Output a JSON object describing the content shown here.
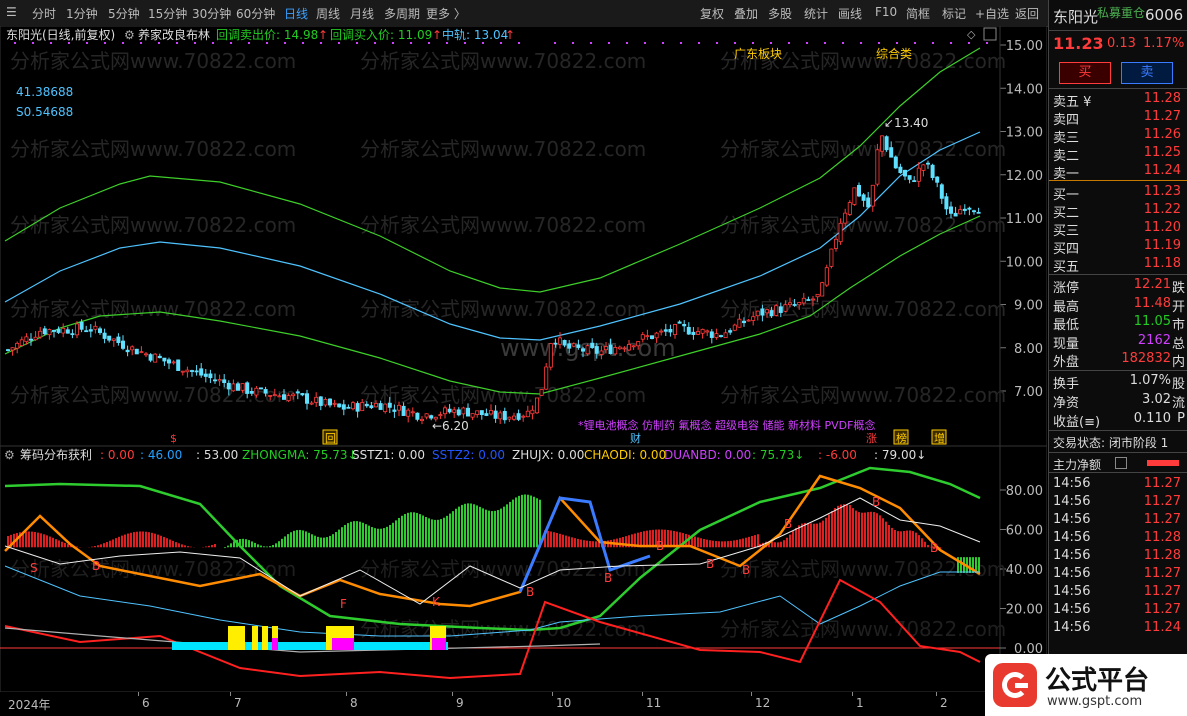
{
  "toolbar": {
    "periods": [
      "分时",
      "1分钟",
      "5分钟",
      "15分钟",
      "30分钟",
      "60分钟",
      "日线",
      "周线",
      "月线",
      "多周期",
      "更多 〉"
    ],
    "active_period": "日线",
    "actions": [
      "复权",
      "叠加",
      "多股",
      "统计",
      "画线",
      "F10",
      "简框",
      "标记",
      "+自选",
      "返回"
    ]
  },
  "main_legend": {
    "stock": "东阳光(日线,前复权)",
    "indicator": "养家改良布林",
    "sell_label": "回调卖出价: 14.98",
    "buy_label": "回调买入价: 11.09",
    "mid_label": "中轨: 13.04",
    "val1": "41.38688",
    "val2": "S0.54688",
    "hi_mark": "13.40",
    "lo_mark": "6.20",
    "tag1": "广东板块",
    "tag2": "综合类",
    "concepts": "*锂电池概念 仿制药 氟概念 超级电容 储能 新材料 PVDF概念",
    "watermark1": "分析家公式网www.70822.com",
    "watermark2": "www.gspt.com",
    "event_marks": [
      "$",
      "回",
      "财",
      "涨",
      "榜",
      "增"
    ]
  },
  "price_axis": [
    "15.00",
    "14.00",
    "13.00",
    "12.00",
    "11.00",
    "10.00",
    "9.00",
    "8.00",
    "7.00"
  ],
  "sub_legend": {
    "name": "筹码分布获利",
    "items": [
      {
        "t": ": 0.00",
        "c": "#ff3b3b"
      },
      {
        "t": ": 46.00",
        "c": "#22a0ff"
      },
      {
        "t": ": 53.00",
        "c": "#dddddd"
      },
      {
        "t": "ZHONGMA: 75.73↓",
        "c": "#22cc22"
      },
      {
        "t": "SSTZ1: 0.00",
        "c": "#dddddd"
      },
      {
        "t": "SSTZ2: 0.00",
        "c": "#2255ff"
      },
      {
        "t": "ZHUJX: 0.00",
        "c": "#dddddd"
      },
      {
        "t": "CHAODI: 0.00",
        "c": "#ffcc00"
      },
      {
        "t": "DUANBD: 0.00",
        "c": "#d040ff"
      },
      {
        "t": ": 75.73↓",
        "c": "#22cc22"
      },
      {
        "t": ": -6.00",
        "c": "#ff3b3b"
      },
      {
        "t": ": 79.00↓",
        "c": "#dddddd"
      }
    ]
  },
  "sub_axis": [
    "80.00",
    "60.00",
    "40.00",
    "20.00",
    "0.00"
  ],
  "dates": [
    "2024年",
    "6",
    "7",
    "8",
    "9",
    "10",
    "11",
    "12",
    "1",
    "2"
  ],
  "side": {
    "name": "东阳光",
    "tag": "私募重仓",
    "code": "6006",
    "price": "11.23",
    "change": "0.13",
    "pct": "1.17%",
    "buy_btn": "买",
    "sell_btn": "卖",
    "asks": [
      {
        "k": "卖五 ¥",
        "v": "11.28"
      },
      {
        "k": "卖四",
        "v": "11.27"
      },
      {
        "k": "卖三",
        "v": "11.26"
      },
      {
        "k": "卖二",
        "v": "11.25"
      },
      {
        "k": "卖一",
        "v": "11.24"
      }
    ],
    "bids": [
      {
        "k": "买一",
        "v": "11.23"
      },
      {
        "k": "买二",
        "v": "11.22"
      },
      {
        "k": "买三",
        "v": "11.20"
      },
      {
        "k": "买四",
        "v": "11.19"
      },
      {
        "k": "买五",
        "v": "11.18"
      }
    ],
    "stats": [
      {
        "k": "涨停",
        "v": "12.21",
        "s": "跌",
        "c": "red"
      },
      {
        "k": "最高",
        "v": "11.48",
        "s": "开",
        "c": "red"
      },
      {
        "k": "最低",
        "v": "11.05",
        "s": "市",
        "c": "green"
      },
      {
        "k": "现量",
        "v": "2162",
        "s": "总",
        "c": "purple"
      },
      {
        "k": "外盘",
        "v": "182832",
        "s": "内",
        "c": "red"
      }
    ],
    "stats2": [
      {
        "k": "换手",
        "v": "1.07%",
        "s": "股"
      },
      {
        "k": "净资",
        "v": "3.02",
        "s": "流"
      },
      {
        "k": "收益(≡)",
        "v": "0.110",
        "s": "P"
      }
    ],
    "status": "交易状态: 闭市阶段 1",
    "flow_label": "主力净额",
    "ticks": [
      {
        "t": "14:56",
        "v": "11.27"
      },
      {
        "t": "14:56",
        "v": "11.27"
      },
      {
        "t": "14:56",
        "v": "11.27"
      },
      {
        "t": "14:56",
        "v": "11.28"
      },
      {
        "t": "14:56",
        "v": "11.28"
      },
      {
        "t": "14:56",
        "v": "11.27"
      },
      {
        "t": "14:56",
        "v": "11.27"
      },
      {
        "t": "14:56",
        "v": "11.27"
      },
      {
        "t": "14:56",
        "v": "11.24"
      }
    ],
    "logo_text": "公式平台",
    "logo_url": "www.gspt.com"
  }
}
